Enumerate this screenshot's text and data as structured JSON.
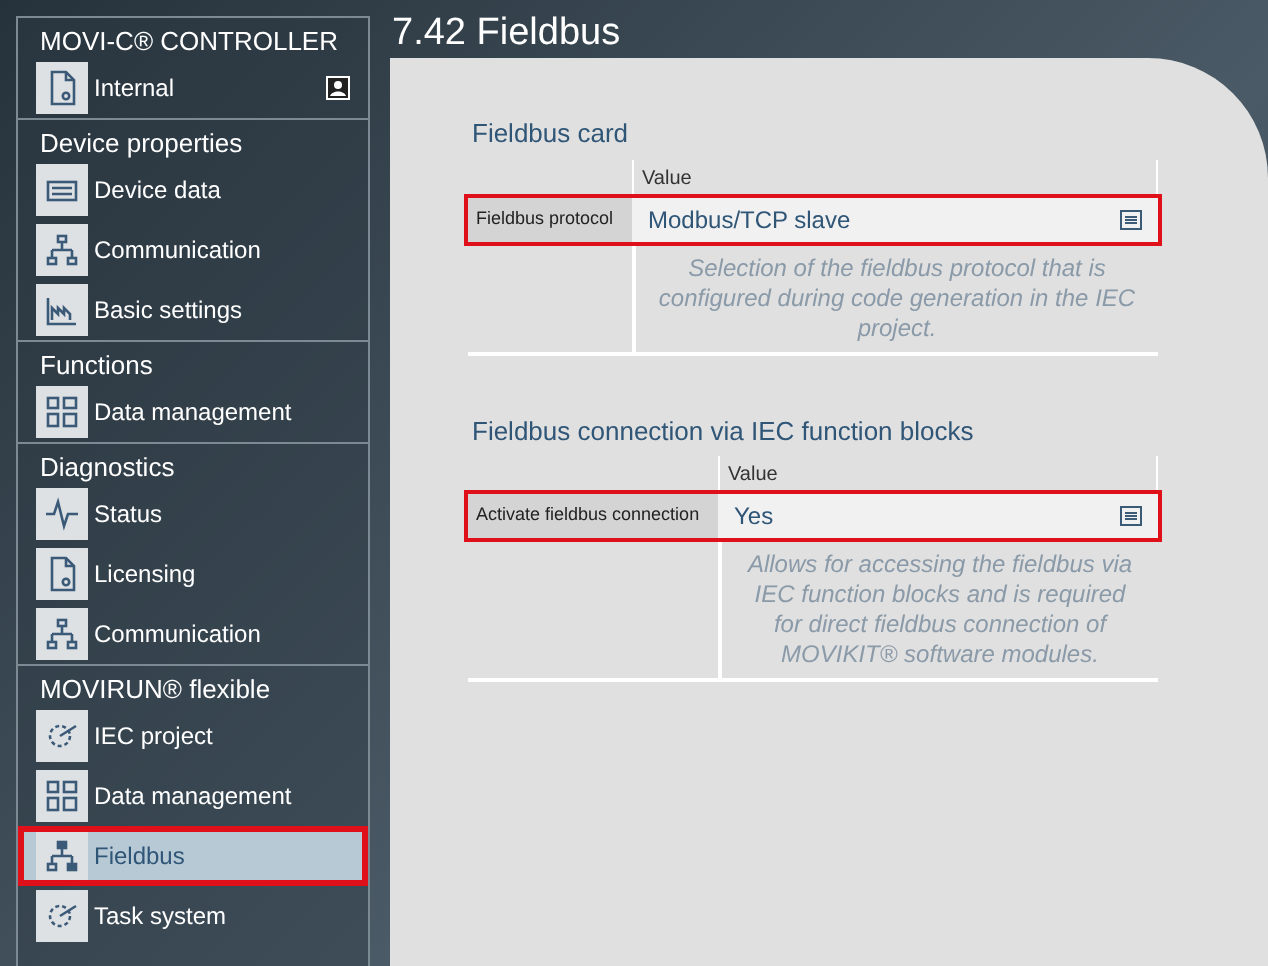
{
  "page_title": "7.42 Fieldbus",
  "sidebar": {
    "sections": [
      {
        "title": "MOVI-C® CONTROLLER",
        "items": [
          {
            "label": "Internal",
            "selected": false,
            "highlighted": false,
            "badge": true
          }
        ]
      },
      {
        "title": "Device properties",
        "items": [
          {
            "label": "Device data",
            "selected": false,
            "highlighted": false,
            "badge": false
          },
          {
            "label": "Communication",
            "selected": false,
            "highlighted": false,
            "badge": false
          },
          {
            "label": "Basic settings",
            "selected": false,
            "highlighted": false,
            "badge": false
          }
        ]
      },
      {
        "title": "Functions",
        "items": [
          {
            "label": "Data management",
            "selected": false,
            "highlighted": false,
            "badge": false
          }
        ]
      },
      {
        "title": "Diagnostics",
        "items": [
          {
            "label": "Status",
            "selected": false,
            "highlighted": false,
            "badge": false
          },
          {
            "label": "Licensing",
            "selected": false,
            "highlighted": false,
            "badge": false
          },
          {
            "label": "Communication",
            "selected": false,
            "highlighted": false,
            "badge": false
          }
        ]
      },
      {
        "title": "MOVIRUN® flexible",
        "items": [
          {
            "label": "IEC project",
            "selected": false,
            "highlighted": false,
            "badge": false
          },
          {
            "label": "Data management",
            "selected": false,
            "highlighted": false,
            "badge": false
          },
          {
            "label": "Fieldbus",
            "selected": true,
            "highlighted": true,
            "badge": false
          },
          {
            "label": "Task system",
            "selected": false,
            "highlighted": false,
            "badge": false
          }
        ]
      }
    ]
  },
  "groups": [
    {
      "title": "Fieldbus card",
      "column_header": "Value",
      "rows": [
        {
          "label": "Fieldbus protocol",
          "value": "Modbus/TCP slave",
          "highlighted": true,
          "description": "Selection of the fieldbus protocol that is configured during code generation in the IEC project."
        }
      ]
    },
    {
      "title": "Fieldbus connection via IEC function blocks",
      "column_header": "Value",
      "rows": [
        {
          "label": "Activate fieldbus connection",
          "value": "Yes",
          "highlighted": true,
          "description": "Allows for accessing the fieldbus via IEC function blocks and is required for direct fieldbus connection of MOVIKIT® software modules."
        }
      ]
    }
  ]
}
